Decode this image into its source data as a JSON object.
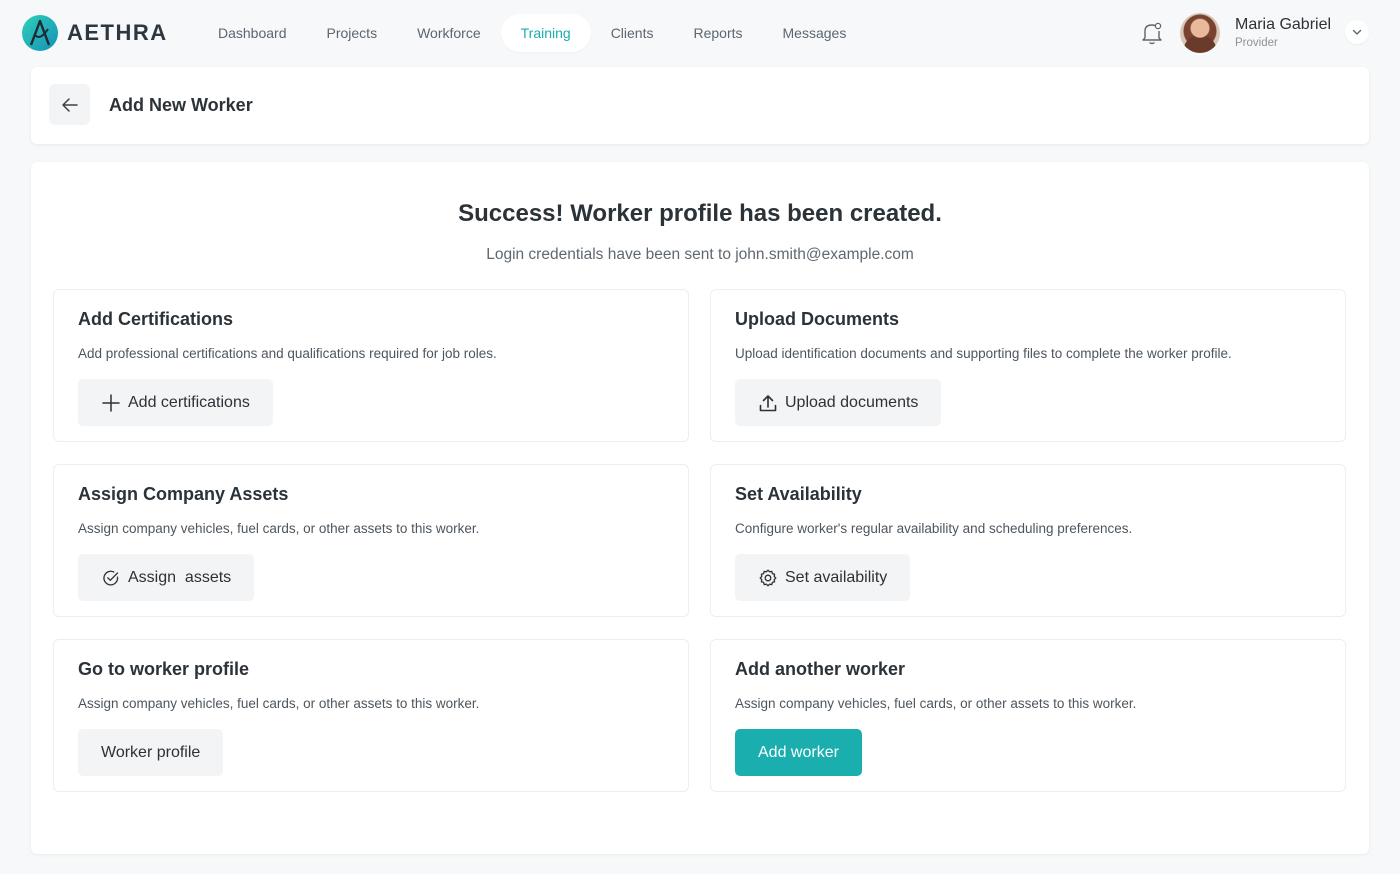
{
  "brand": {
    "name": "AETHRA",
    "accent_color": "#1aaeaf"
  },
  "nav": {
    "items": [
      {
        "label": "Dashboard",
        "active": false
      },
      {
        "label": "Projects",
        "active": false
      },
      {
        "label": "Workforce",
        "active": false
      },
      {
        "label": "Training",
        "active": true
      },
      {
        "label": "Clients",
        "active": false
      },
      {
        "label": "Reports",
        "active": false
      },
      {
        "label": "Messages",
        "active": false
      }
    ]
  },
  "user": {
    "name": "Maria Gabriel",
    "role": "Provider"
  },
  "header": {
    "title": "Add New Worker"
  },
  "success": {
    "title": "Success! Worker profile has been created.",
    "subtitle": "Login credentials have been sent to john.smith@example.com"
  },
  "actions": [
    {
      "title": "Add Certifications",
      "description": "Add professional certifications and qualifications required for job roles.",
      "button_label": "Add certifications",
      "icon": "plus-icon"
    },
    {
      "title": "Upload Documents",
      "description": "Upload identification documents and supporting files to complete the worker profile.",
      "button_label": "Upload documents",
      "icon": "upload-icon"
    },
    {
      "title": "Assign Company Assets",
      "description": "Assign company vehicles, fuel cards, or other assets to this worker.",
      "button_label": "Assign  assets",
      "icon": "check-circle-icon"
    },
    {
      "title": "Set Availability",
      "description": "Configure worker's regular availability and scheduling preferences.",
      "button_label": "Set availability",
      "icon": "gear-icon"
    },
    {
      "title": "Go to worker profile",
      "description": "Assign company vehicles, fuel cards, or other assets to this worker.",
      "button_label": "Worker profile",
      "icon": ""
    },
    {
      "title": "Add another worker",
      "description": "Assign company vehicles, fuel cards, or other assets to this worker.",
      "button_label": "Add worker",
      "icon": ""
    }
  ]
}
